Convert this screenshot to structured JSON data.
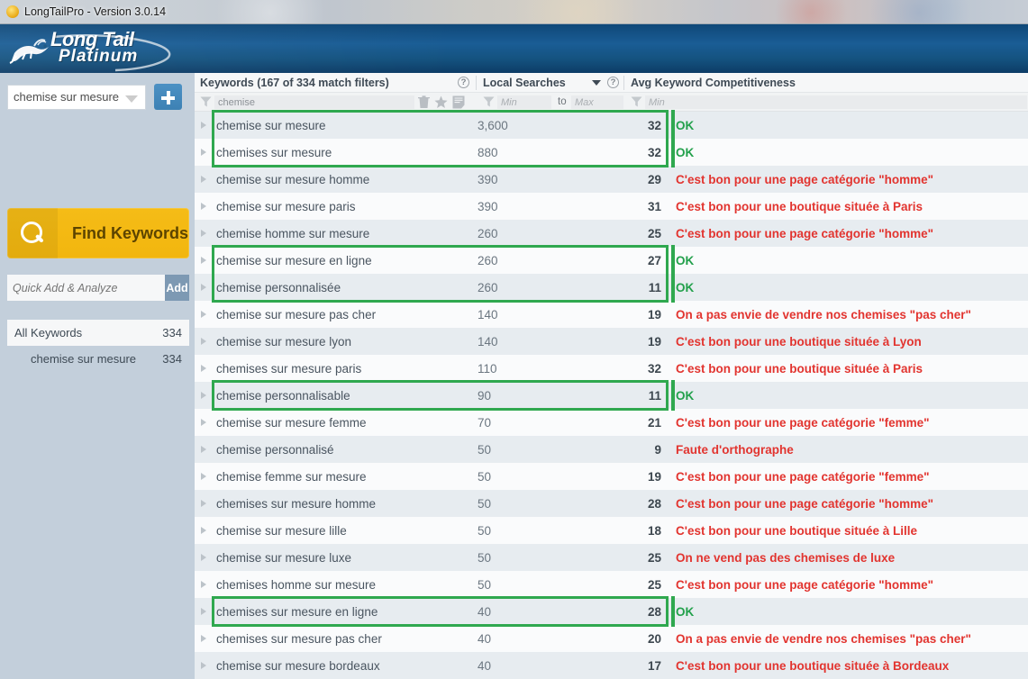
{
  "window": {
    "title": "LongTailPro - Version 3.0.14",
    "icon": "app-flame-icon"
  },
  "brand": {
    "line1": "Long Tail",
    "line2": "Platinum"
  },
  "sidebar": {
    "keyword_select": {
      "value": "chemise sur mesure",
      "caret": "chevron-down-icon"
    },
    "add_project_button": "+",
    "find_keywords_button": "Find Keywords",
    "quick_add": {
      "placeholder": "Quick Add & Analyze",
      "value": "",
      "button": "Add"
    },
    "groups": [
      {
        "label": "All Keywords",
        "count": "334",
        "selected": true,
        "child": false
      },
      {
        "label": "chemise sur mesure",
        "count": "334",
        "selected": false,
        "child": true
      }
    ]
  },
  "grid": {
    "columns": [
      {
        "title": "Keywords (167 of 334 match filters)",
        "help": "help-icon"
      },
      {
        "title": "Local Searches",
        "sort": "sort-desc-icon",
        "help": "help-icon"
      },
      {
        "title": "Avg Keyword Competitiveness",
        "help": ""
      }
    ],
    "filters": {
      "keyword_value": "chemise",
      "local_min_placeholder": "Min",
      "local_to_label": "to",
      "local_max_placeholder": "Max",
      "akc_min_placeholder": "Min",
      "icons": [
        "trash-icon",
        "star-icon",
        "notes-icon"
      ]
    },
    "rows": [
      {
        "keyword": "chemise sur mesure",
        "local": "3,600",
        "akc": "32",
        "note": "OK",
        "note_type": "ok",
        "highlight": "start"
      },
      {
        "keyword": "chemises sur mesure",
        "local": "880",
        "akc": "32",
        "note": "OK",
        "note_type": "ok",
        "highlight": "end"
      },
      {
        "keyword": "chemise sur mesure homme",
        "local": "390",
        "akc": "29",
        "note": "C'est bon pour une page catégorie \"homme\"",
        "note_type": "bad",
        "highlight": "none"
      },
      {
        "keyword": "chemise sur mesure paris",
        "local": "390",
        "akc": "31",
        "note": "C'est bon pour une boutique située à Paris",
        "note_type": "bad",
        "highlight": "none"
      },
      {
        "keyword": "chemise homme sur mesure",
        "local": "260",
        "akc": "25",
        "note": "C'est bon pour une page catégorie \"homme\"",
        "note_type": "bad",
        "highlight": "none"
      },
      {
        "keyword": "chemise sur mesure en ligne",
        "local": "260",
        "akc": "27",
        "note": "OK",
        "note_type": "ok",
        "highlight": "start"
      },
      {
        "keyword": "chemise personnalisée",
        "local": "260",
        "akc": "11",
        "note": "OK",
        "note_type": "ok",
        "highlight": "end"
      },
      {
        "keyword": "chemise sur mesure pas cher",
        "local": "140",
        "akc": "19",
        "note": "On a pas envie de vendre nos chemises \"pas cher\"",
        "note_type": "bad",
        "highlight": "none"
      },
      {
        "keyword": "chemise sur mesure lyon",
        "local": "140",
        "akc": "19",
        "note": "C'est bon pour une boutique située à Lyon",
        "note_type": "bad",
        "highlight": "none"
      },
      {
        "keyword": "chemises sur mesure paris",
        "local": "110",
        "akc": "32",
        "note": "C'est bon pour une boutique située à Paris",
        "note_type": "bad",
        "highlight": "none"
      },
      {
        "keyword": "chemise personnalisable",
        "local": "90",
        "akc": "11",
        "note": "OK",
        "note_type": "ok",
        "highlight": "single"
      },
      {
        "keyword": "chemise sur mesure femme",
        "local": "70",
        "akc": "21",
        "note": "C'est bon pour une page catégorie \"femme\"",
        "note_type": "bad",
        "highlight": "none"
      },
      {
        "keyword": "chemise personnalisé",
        "local": "50",
        "akc": "9",
        "note": "Faute d'orthographe",
        "note_type": "bad",
        "highlight": "none"
      },
      {
        "keyword": "chemise femme sur mesure",
        "local": "50",
        "akc": "19",
        "note": "C'est bon pour une page catégorie \"femme\"",
        "note_type": "bad",
        "highlight": "none"
      },
      {
        "keyword": "chemises sur mesure homme",
        "local": "50",
        "akc": "28",
        "note": "C'est bon pour une page catégorie \"homme\"",
        "note_type": "bad",
        "highlight": "none"
      },
      {
        "keyword": "chemise sur mesure lille",
        "local": "50",
        "akc": "18",
        "note": "C'est bon pour une boutique située à Lille",
        "note_type": "bad",
        "highlight": "none"
      },
      {
        "keyword": "chemise sur mesure luxe",
        "local": "50",
        "akc": "25",
        "note": "On ne vend pas des chemises de luxe",
        "note_type": "bad",
        "highlight": "none"
      },
      {
        "keyword": "chemises homme sur mesure",
        "local": "50",
        "akc": "25",
        "note": "C'est bon pour une page catégorie \"homme\"",
        "note_type": "bad",
        "highlight": "none"
      },
      {
        "keyword": "chemises sur mesure en ligne",
        "local": "40",
        "akc": "28",
        "note": "OK",
        "note_type": "ok",
        "highlight": "single"
      },
      {
        "keyword": "chemises sur mesure pas cher",
        "local": "40",
        "akc": "20",
        "note": "On a pas envie de vendre nos chemises \"pas cher\"",
        "note_type": "bad",
        "highlight": "none"
      },
      {
        "keyword": "chemise sur mesure bordeaux",
        "local": "40",
        "akc": "17",
        "note": "C'est bon pour une boutique située à Bordeaux",
        "note_type": "bad",
        "highlight": "none"
      }
    ]
  },
  "colors": {
    "brand_blue": "#14527f",
    "accent_yellow": "#f2b60e",
    "highlight_green": "#2fa84f",
    "note_ok": "#22a04b",
    "note_bad": "#e2342f",
    "row_even": "#e7ecf0",
    "row_odd": "#fafbfc",
    "sidebar": "#c3cfdb"
  }
}
